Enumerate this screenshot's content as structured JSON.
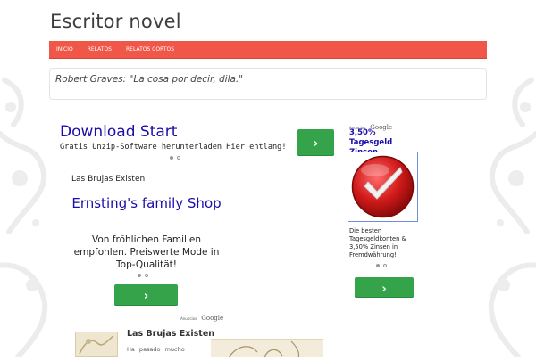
{
  "site": {
    "title": "Escritor novel"
  },
  "nav": {
    "items": [
      "INICIO",
      "RELATOS",
      "RELATOS CORTOS"
    ]
  },
  "quote": {
    "text": "Robert Graves: \"La cosa por decir, dila.\""
  },
  "ad_top": {
    "title": "Download Start",
    "description": "Gratis Unzip-Software herunterladen Hier entlang!",
    "button_icon": "chevron-right-icon"
  },
  "ad_side": {
    "brand_small": "Anuncios",
    "brand_google": "Google",
    "title": "3,50% Tagesgeld Zinsen",
    "image_icon": "red-checkmark-icon",
    "description": "Die besten Tagesgeldkonten & 3,50% Zinsen in Fremdwährung!",
    "button_icon": "chevron-right-icon"
  },
  "section": {
    "label": "Las Brujas Existen"
  },
  "ad_mid": {
    "title": "Ernsting's family Shop",
    "description": "Von fröhlichen Familien empfohlen. Preiswerte Mode in Top-Qualität!",
    "brand_small": "Anuncios",
    "brand_google": "Google",
    "button_icon": "chevron-right-icon"
  },
  "post": {
    "title": "Las Brujas Existen",
    "excerpt": "Ha pasado mucho"
  },
  "colors": {
    "nav_bg": "#f15749",
    "button_green": "#34a34a",
    "ad_link": "#1a0dab"
  }
}
